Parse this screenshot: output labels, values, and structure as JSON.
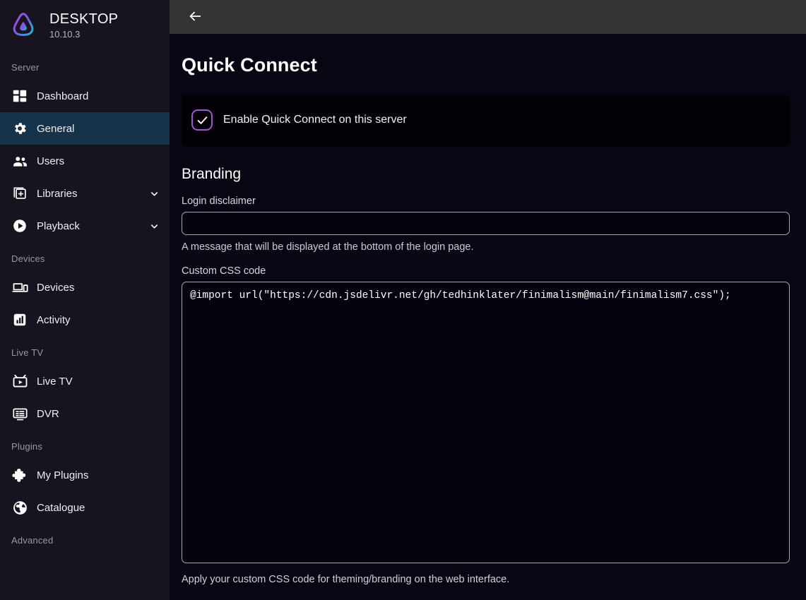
{
  "sidebar": {
    "brand": {
      "title": "DESKTOP",
      "version": "10.10.3",
      "logo_icon": "jellyfin-logo-icon"
    },
    "groups": [
      {
        "heading": "Server",
        "items": [
          {
            "label": "Dashboard",
            "icon": "dashboard-icon",
            "active": false,
            "expandable": false
          },
          {
            "label": "General",
            "icon": "gear-icon",
            "active": true,
            "expandable": false
          },
          {
            "label": "Users",
            "icon": "users-icon",
            "active": false,
            "expandable": false
          },
          {
            "label": "Libraries",
            "icon": "library-add-icon",
            "active": false,
            "expandable": true
          },
          {
            "label": "Playback",
            "icon": "play-circle-icon",
            "active": false,
            "expandable": true
          }
        ]
      },
      {
        "heading": "Devices",
        "items": [
          {
            "label": "Devices",
            "icon": "devices-icon",
            "active": false,
            "expandable": false
          },
          {
            "label": "Activity",
            "icon": "activity-chart-icon",
            "active": false,
            "expandable": false
          }
        ]
      },
      {
        "heading": "Live TV",
        "items": [
          {
            "label": "Live TV",
            "icon": "live-tv-icon",
            "active": false,
            "expandable": false
          },
          {
            "label": "DVR",
            "icon": "dvr-icon",
            "active": false,
            "expandable": false
          }
        ]
      },
      {
        "heading": "Plugins",
        "items": [
          {
            "label": "My Plugins",
            "icon": "puzzle-piece-icon",
            "active": false,
            "expandable": false
          },
          {
            "label": "Catalogue",
            "icon": "globe-icon",
            "active": false,
            "expandable": false
          }
        ]
      },
      {
        "heading": "Advanced",
        "items": []
      }
    ]
  },
  "topbar": {
    "back_icon": "arrow-left-icon"
  },
  "main": {
    "page_title": "Quick Connect",
    "quick_connect": {
      "checkbox_checked": true,
      "checkbox_icon": "check-icon",
      "label": "Enable Quick Connect on this server"
    },
    "branding": {
      "section_title": "Branding",
      "login_disclaimer": {
        "label": "Login disclaimer",
        "value": "",
        "placeholder": "",
        "hint": "A message that will be displayed at the bottom of the login page."
      },
      "custom_css": {
        "label": "Custom CSS code",
        "value": "@import url(\"https://cdn.jsdelivr.net/gh/tedhinklater/finimalism@main/finimalism7.css\");",
        "placeholder": "",
        "hint": "Apply your custom CSS code for theming/branding on the web interface."
      }
    }
  },
  "colors": {
    "sidebar_bg": "#17141f",
    "content_bg": "#0a0513",
    "topbar_bg": "#333333",
    "active_item_bg": "#16334a",
    "accent_purple": "#9b59d0",
    "card_bg": "#040008",
    "input_border": "#a9a5b8"
  }
}
